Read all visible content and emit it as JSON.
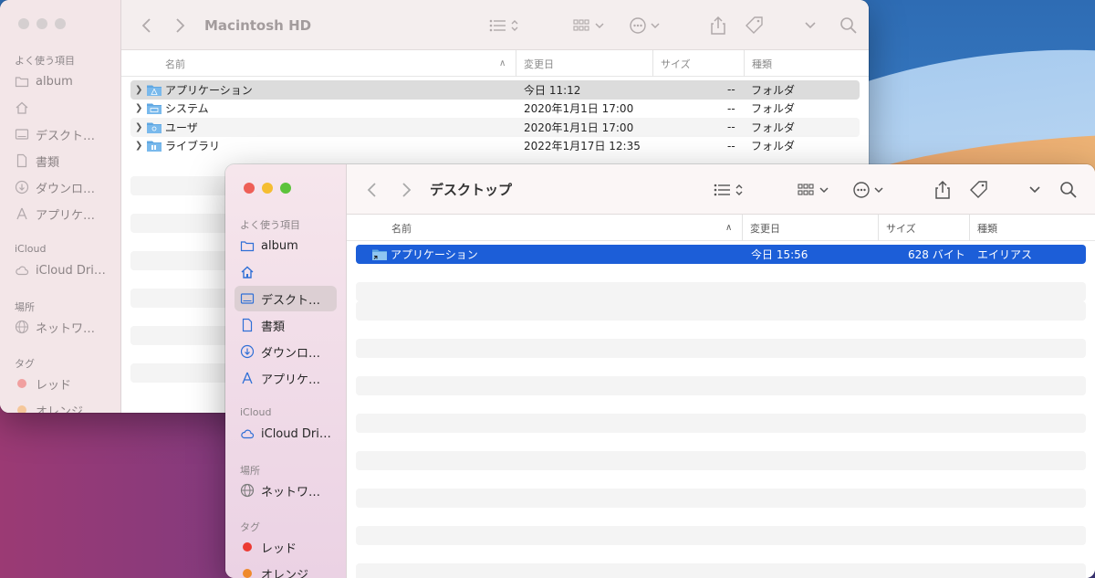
{
  "back_window": {
    "title": "Macintosh HD",
    "sidebar": {
      "favorites_header": "よく使う項目",
      "favorites": [
        "album",
        "",
        "デスクト…",
        "書類",
        "ダウンロ…",
        "アプリケ…"
      ],
      "icloud_header": "iCloud",
      "icloud_items": [
        "iCloud Dri…"
      ],
      "locations_header": "場所",
      "locations": [
        "ネットワ…"
      ],
      "tags_header": "タグ",
      "tags": [
        {
          "label": "レッド",
          "color": "#f19f9f"
        },
        {
          "label": "オレンジ",
          "color": "#f5c79a"
        }
      ]
    },
    "columns": {
      "name": "名前",
      "modified": "変更日",
      "size": "サイズ",
      "kind": "種類"
    },
    "rows": [
      {
        "name": "アプリケーション",
        "modified": "今日 11:12",
        "size": "--",
        "kind": "フォルダ"
      },
      {
        "name": "システム",
        "modified": "2020年1月1日 17:00",
        "size": "--",
        "kind": "フォルダ"
      },
      {
        "name": "ユーザ",
        "modified": "2020年1月1日 17:00",
        "size": "--",
        "kind": "フォルダ"
      },
      {
        "name": "ライブラリ",
        "modified": "2022年1月17日 12:35",
        "size": "--",
        "kind": "フォルダ"
      }
    ]
  },
  "front_window": {
    "title": "デスクトップ",
    "sidebar": {
      "favorites_header": "よく使う項目",
      "favorites": [
        "album",
        "",
        "デスクト…",
        "書類",
        "ダウンロ…",
        "アプリケ…"
      ],
      "icloud_header": "iCloud",
      "icloud_items": [
        "iCloud Dri…"
      ],
      "locations_header": "場所",
      "locations": [
        "ネットワ…"
      ],
      "tags_header": "タグ",
      "tags": [
        {
          "label": "レッド",
          "color": "#ec3a32"
        },
        {
          "label": "オレンジ",
          "color": "#ef8a2b"
        }
      ]
    },
    "columns": {
      "name": "名前",
      "modified": "変更日",
      "size": "サイズ",
      "kind": "種類"
    },
    "rows": [
      {
        "name": "アプリケーション",
        "modified": "今日 15:56",
        "size": "628 バイト",
        "kind": "エイリアス"
      }
    ]
  },
  "icons": {
    "back": "chevron-left-icon",
    "forward": "chevron-right-icon",
    "list_view": "list-view-icon",
    "group": "grid-group-icon",
    "more": "ellipsis-circle-icon",
    "share": "share-icon",
    "tag": "tag-icon",
    "dropdown": "chevron-down-icon",
    "search": "search-icon"
  },
  "colors": {
    "selection_blue": "#1c5ed8",
    "folder_blue": "#5fa7e2"
  }
}
